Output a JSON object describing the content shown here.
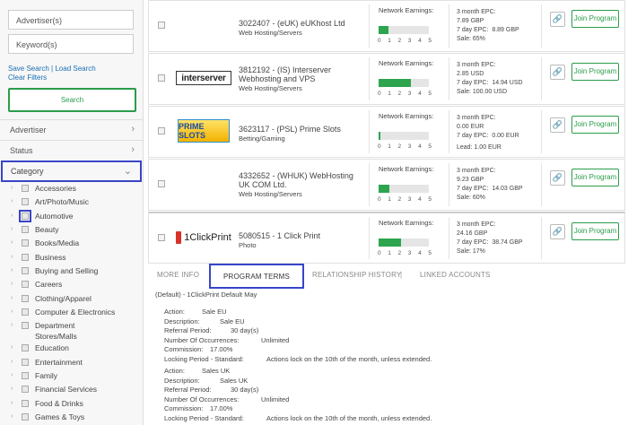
{
  "sidebar": {
    "advertiser_placeholder": "Advertiser(s)",
    "keyword_placeholder": "Keyword(s)",
    "save_search": "Save Search",
    "load_search": "Load Search",
    "link_sep": " | ",
    "clear_filters": "Clear Filters",
    "search_label": "Search",
    "filters": [
      {
        "label": "Advertiser",
        "icon": "chevron-right-icon"
      },
      {
        "label": "Status",
        "icon": "chevron-right-icon"
      }
    ],
    "category_label": "Category",
    "category_icon": "chevron-down-icon",
    "categories": [
      "Accessories",
      "Art/Photo/Music",
      "Automotive",
      "Beauty",
      "Books/Media",
      "Business",
      "Buying and Selling",
      "Careers",
      "Clothing/Apparel",
      "Computer & Electronics",
      "Department Stores/Malls",
      "Education",
      "Entertainment",
      "Family",
      "Financial Services",
      "Food & Drinks",
      "Games & Toys"
    ],
    "category_line2": "Stores/Malls",
    "category_line1": "Department"
  },
  "programs": [
    {
      "id": "3022407 - (eUK) eUKhost Ltd",
      "category": "Web Hosting/Servers",
      "logo": "",
      "earnings_label": "Network Earnings:",
      "earnings_level": 0.2,
      "epc3": "3 month EPC:",
      "epc3_val": "7.89 GBP",
      "epc7": "7 day EPC:",
      "epc7_val": "8.89 GBP",
      "extra": "Sale: 65%",
      "join": "Join Program"
    },
    {
      "id": "3812192 - (IS) Interserver Webhosting and VPS",
      "category": "Web Hosting/Servers",
      "logo": "interserver",
      "earnings_label": "Network Earnings:",
      "earnings_level": 0.65,
      "epc3": "3 month EPC:",
      "epc3_val": "2.85 USD",
      "epc7": "7 day EPC:",
      "epc7_val": "14.94 USD",
      "extra": "Sale: 100.00 USD",
      "join": "Join Program"
    },
    {
      "id": "3623117 - (PSL) Prime Slots",
      "category": "Betting/Gaming",
      "logo": "PRIME SLOTS",
      "earnings_label": "Network Earnings:",
      "earnings_level": 0.04,
      "epc3": "3 month EPC:",
      "epc3_val": "0.00 EUR",
      "epc7": "7 day EPC:",
      "epc7_val": "0.00 EUR",
      "extra": "Lead: 1.00 EUR",
      "join": "Join Program"
    },
    {
      "id": "4332652 - (WHUK) WebHosting UK COM Ltd.",
      "category": "Web Hosting/Servers",
      "logo": "",
      "earnings_label": "Network Earnings:",
      "earnings_level": 0.22,
      "epc3": "3 month EPC:",
      "epc3_val": "9.23 GBP",
      "epc7": "7 day EPC:",
      "epc7_val": "14.03 GBP",
      "extra": "Sale: 60%",
      "join": "Join Program"
    },
    {
      "id": "5080515 - 1 Click Print",
      "category": "Photo",
      "logo": "1ClickPrint",
      "earnings_label": "Network Earnings:",
      "earnings_level": 0.45,
      "epc3": "3 month EPC:",
      "epc3_val": "24.16 GBP",
      "epc7": "7 day EPC:",
      "epc7_val": "38.74 GBP",
      "extra": "Sale: 17%",
      "join": "Join Program"
    }
  ],
  "scale_ticks": [
    "0",
    "1",
    "2",
    "3",
    "4",
    "5"
  ],
  "tabs": {
    "more_info": "MORE INFO",
    "program_terms": "PROGRAM TERMS",
    "relationship_history": "RELATIONSHIP HISTORY",
    "sep": "|",
    "linked_accounts": "LINKED ACCOUNTS"
  },
  "terms": {
    "default_label": "(Default) - 1ClickPrint Default May",
    "labels": {
      "action": "Action:",
      "description": "Description:",
      "referral": "Referral Period:",
      "occurrences": "Number Of Occurrences:",
      "commission": "Commission:",
      "locking": "Locking Period - Standard:"
    },
    "blocks": [
      {
        "action": "Sale EU",
        "description": "Sale EU",
        "referral": "30 day(s)",
        "occurrences": "Unlimited",
        "commission": "17.00%",
        "locking": "Actions lock on the 10th of the month, unless extended."
      },
      {
        "action": "Sales UK",
        "description": "Sales UK",
        "referral": "30 day(s)",
        "occurrences": "Unlimited",
        "commission": "17.00%",
        "locking": "Actions lock on the 10th of the month, unless extended."
      }
    ]
  },
  "colors": {
    "accent_green": "#2a9d4a",
    "highlight_blue": "#3845c8",
    "link_blue": "#1a6fb4"
  }
}
